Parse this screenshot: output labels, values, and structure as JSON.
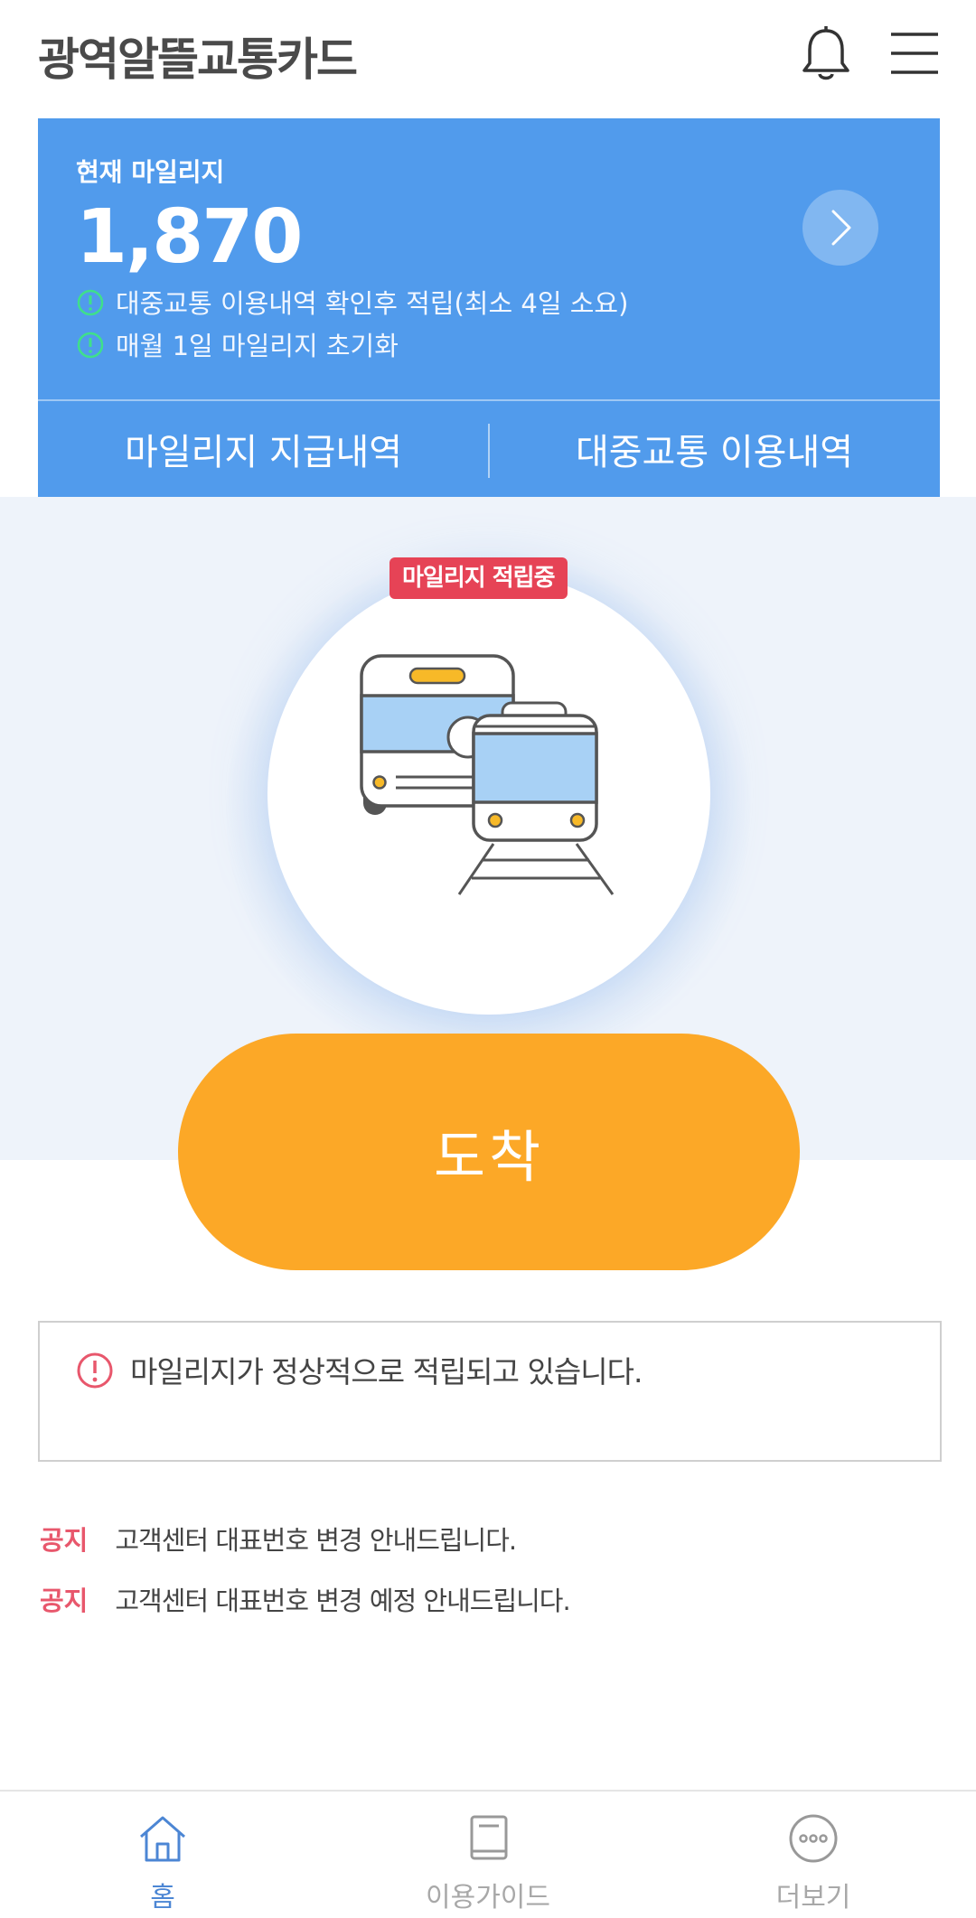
{
  "header": {
    "title": "광역알뜰교통카드",
    "bell_icon": "bell-icon",
    "menu_icon": "hamburger-menu-icon"
  },
  "mileage": {
    "label": "현재 마일리지",
    "value": "1,870",
    "info": [
      "대중교통 이용내역 확인후 적립(최소 4일 소요)",
      "매월 1일 마일리지 초기화"
    ],
    "tabs": [
      {
        "label": "마일리지 지급내역"
      },
      {
        "label": "대중교통 이용내역"
      }
    ],
    "card_color": "#519bec",
    "info_icon_color": "#3fe08a"
  },
  "hero": {
    "badge": "마일리지 적립중",
    "badge_color": "#e64356",
    "illustration": "bus-and-train-icon"
  },
  "arrive_button": {
    "label": "도착",
    "color": "#fca827"
  },
  "message": {
    "text": "마일리지가 정상적으로 적립되고 있습니다.",
    "icon_color": "#e8576c"
  },
  "notices": [
    {
      "tag": "공지",
      "text": "고객센터 대표번호 변경 안내드립니다."
    },
    {
      "tag": "공지",
      "text": "고객센터 대표번호 변경 예정 안내드립니다."
    }
  ],
  "bottom_nav": [
    {
      "label": "홈",
      "icon": "home-icon",
      "active": true
    },
    {
      "label": "이용가이드",
      "icon": "book-icon",
      "active": false
    },
    {
      "label": "더보기",
      "icon": "more-icon",
      "active": false
    }
  ]
}
